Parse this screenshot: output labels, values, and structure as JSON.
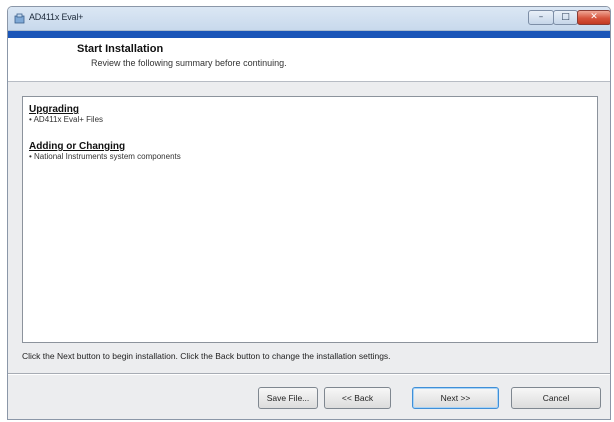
{
  "window": {
    "title": "AD411x Eval+",
    "controls": {
      "minimize": "–",
      "maximize": "□",
      "close": "✕"
    }
  },
  "header": {
    "title": "Start Installation",
    "subtitle": "Review the following summary before continuing."
  },
  "summary": {
    "sections": [
      {
        "heading": "Upgrading",
        "items": [
          "• AD411x Eval+ Files"
        ]
      },
      {
        "heading": "Adding or Changing",
        "items": [
          "• National Instruments system components"
        ]
      }
    ]
  },
  "status_text": "Click the Next button to begin installation.  Click the Back button to change the installation settings.",
  "buttons": {
    "save": "Save File...",
    "back": "<< Back",
    "next": "Next >>",
    "cancel": "Cancel"
  },
  "colors": {
    "accent_strip": "#1a55b8",
    "close_button": "#d6543d",
    "default_button_border": "#3f8fd8"
  }
}
